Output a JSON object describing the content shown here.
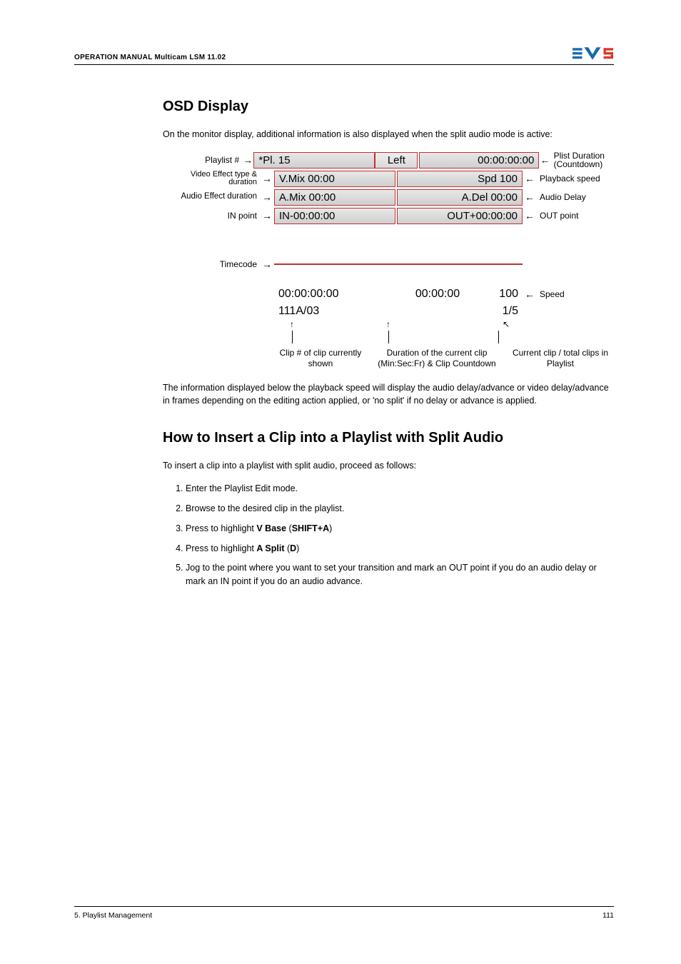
{
  "header": {
    "title": "OPERATION MANUAL Multicam LSM 11.02"
  },
  "section1": {
    "heading": "OSD Display",
    "p1": "On the monitor display, additional information is also displayed when the split audio mode is active:",
    "p2": "The information displayed below the playback speed will display the audio delay/advance or video delay/advance in frames depending on the editing action applied, or 'no split' if no delay or advance is applied."
  },
  "figure": {
    "left_labels": {
      "playlist": "Playlist #",
      "video_effect": "Video Effect type & duration",
      "audio_effect_duration": "Audio Effect duration",
      "in_point": "IN point",
      "timecode": "Timecode"
    },
    "right_labels": {
      "plist_duration": "Plist Duration (Countdown)",
      "playback_speed": "Playback speed",
      "audio_delay": "Audio Delay",
      "out_point": "OUT point",
      "speed": "Speed"
    },
    "row1": {
      "pl": "*Pl. 15",
      "center": "Left",
      "dur": "00:00:00:00"
    },
    "row2": {
      "vmix": "V.Mix  00:00",
      "spd": "Spd  100"
    },
    "row3": {
      "amix": "A.Mix  00:00",
      "adel": "A.Del  00:00"
    },
    "row4": {
      "in": "IN-00:00:00",
      "out": "OUT+00:00:00"
    },
    "row_tc": {
      "tc": "00:00:00:00",
      "dur": "00:00:00",
      "spd": "100"
    },
    "row_clip": {
      "clip": "111A/03",
      "pos": "1/5"
    },
    "bottom": {
      "c1": "Clip # of clip currently shown",
      "c2": "Duration of the current clip (Min:Sec:Fr) & Clip Countdown",
      "c3": "Current clip / total clips in Playlist"
    }
  },
  "section2": {
    "heading": "How to Insert a Clip into a Playlist with Split Audio",
    "intro": "To insert a clip into a playlist with split audio, proceed as follows:",
    "steps": {
      "s1": "Enter the Playlist Edit mode.",
      "s2": "Browse to the desired clip in the playlist.",
      "s3_pre": "Press to highlight ",
      "s3_b1": "V Base",
      "s3_mid": " (",
      "s3_b2": "SHIFT+A",
      "s3_post": ")",
      "s4_pre": "Press to highlight ",
      "s4_b1": "A Split",
      "s4_mid": " (",
      "s4_b2": "D",
      "s4_post": ")",
      "s5": "Jog to the point where you want to set your transition and mark an OUT point if you do an audio delay or mark an IN point if you do an audio advance."
    }
  },
  "footer": {
    "left": "5. Playlist Management",
    "right": "111"
  }
}
